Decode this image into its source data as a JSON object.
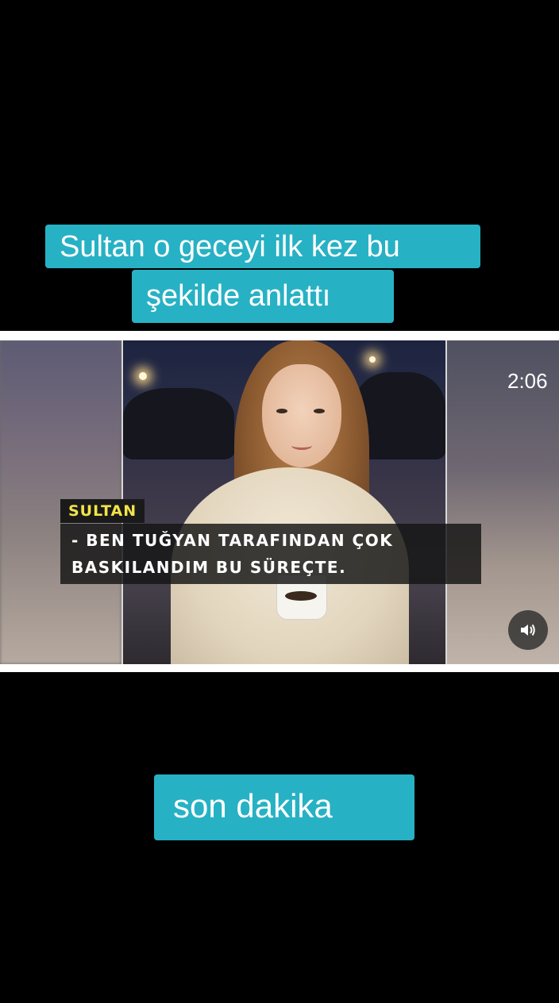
{
  "captions": {
    "top_line1": "Sultan o geceyi ilk kez bu",
    "top_line2": "şekilde anlattı",
    "bottom": "son dakika"
  },
  "video": {
    "duration": "2:06",
    "name_tag": "SULTAN",
    "subtitle_line1": "- BEN TUĞYAN TARAFINDAN ÇOK",
    "subtitle_line2": "BASKILANDIM BU SÜREÇTE.",
    "volume_icon": "speaker-icon"
  },
  "colors": {
    "caption_bg": "#27b1c4",
    "name_tag_text": "#f1e44a",
    "background": "#000000"
  }
}
